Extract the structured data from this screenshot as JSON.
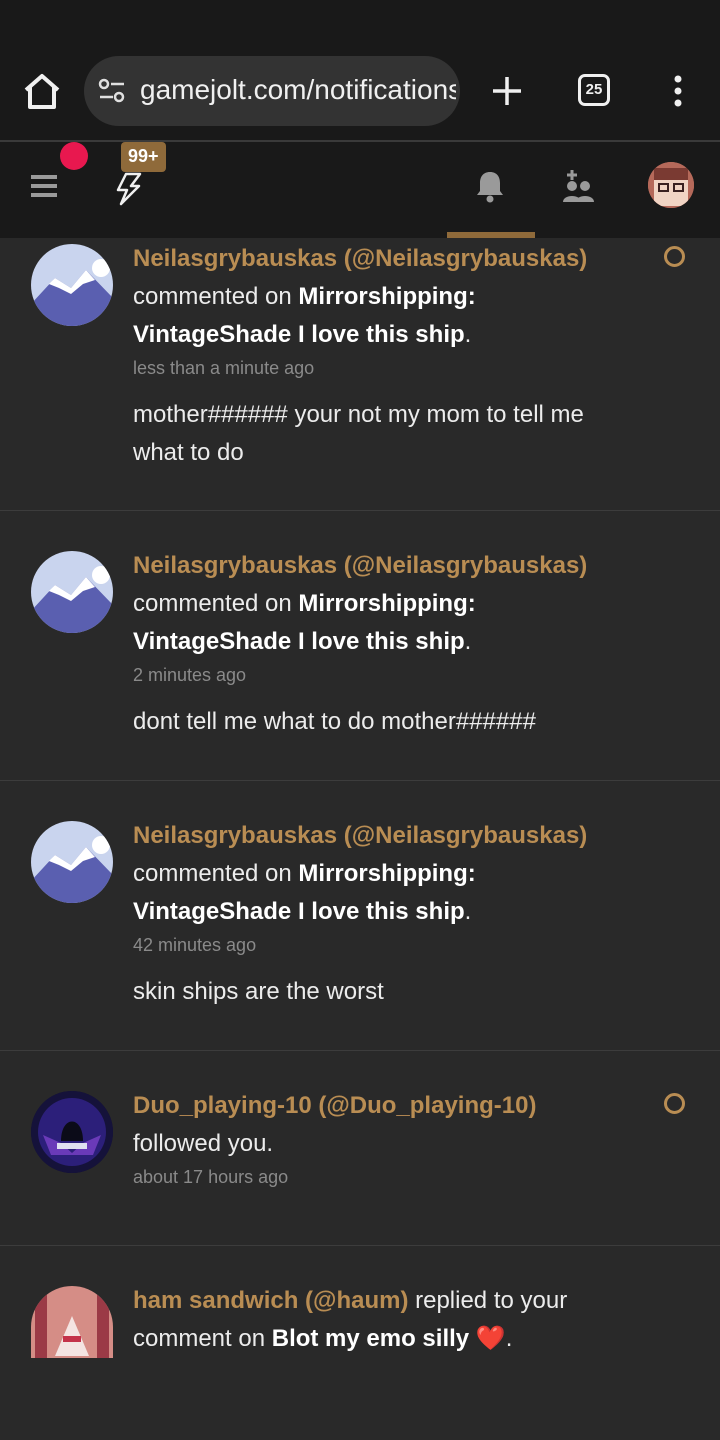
{
  "browser": {
    "url": "gamejolt.com/notifications",
    "tab_count": "25"
  },
  "header": {
    "activity_count": "99+"
  },
  "notifications": [
    {
      "author": "Neilasgrybauskas (@Neilasgrybauskas)",
      "action": " commented on ",
      "target": "Mirrorshipping: VintageShade I love this ship",
      "suffix": ".",
      "time": "less than a minute ago",
      "comment": "mother###### your not my mom to tell me what to do"
    },
    {
      "author": "Neilasgrybauskas (@Neilasgrybauskas)",
      "action": " commented on ",
      "target": "Mirrorshipping: VintageShade I love this ship",
      "suffix": ".",
      "time": "2 minutes ago",
      "comment": "dont tell me what to do mother######"
    },
    {
      "author": "Neilasgrybauskas (@Neilasgrybauskas)",
      "action": " commented on ",
      "target": "Mirrorshipping: VintageShade I love this ship",
      "suffix": ".",
      "time": "42 minutes ago",
      "comment": "skin ships are the worst"
    },
    {
      "author": "Duo_playing-10 (@Duo_playing-10)",
      "action": " followed you.",
      "time": "about 17 hours ago"
    },
    {
      "author": "ham sandwich (@haum)",
      "action": " replied to your comment on ",
      "target": "Blot my emo silly",
      "emoji": "❤️",
      "suffix": "."
    }
  ]
}
